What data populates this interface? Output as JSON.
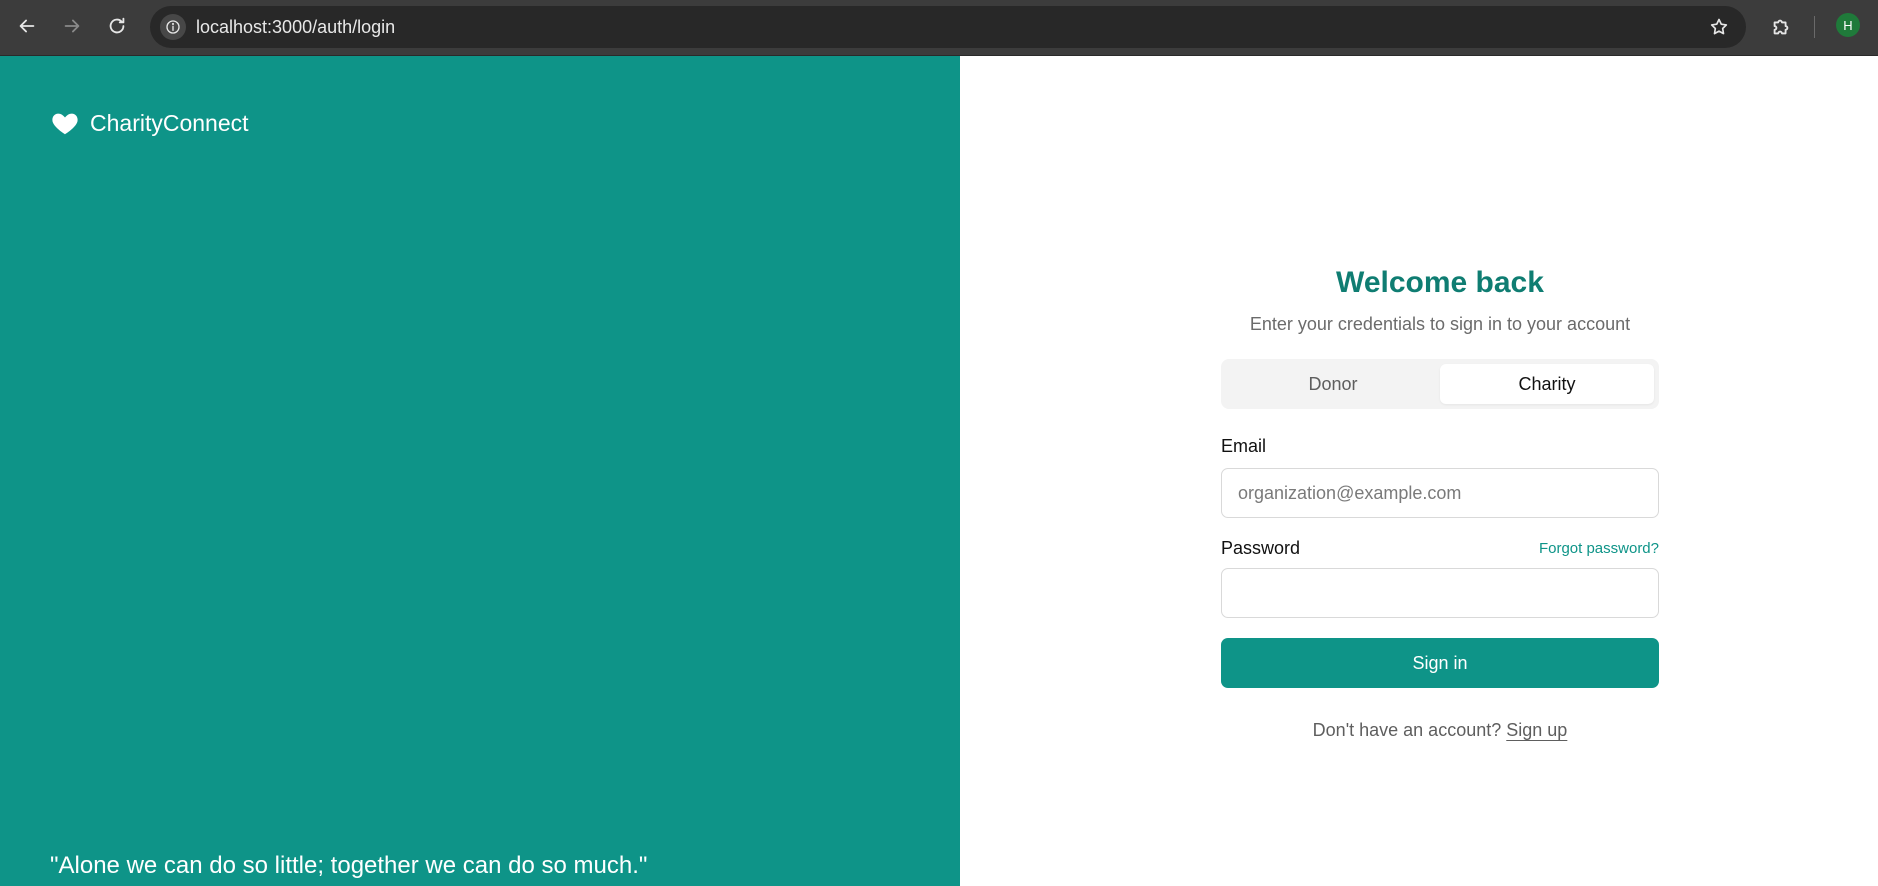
{
  "browser": {
    "url": "localhost:3000/auth/login",
    "profile_initial": "H",
    "profile_color": "#1f7a3a"
  },
  "icons": {
    "back": "arrow-left-icon",
    "forward": "arrow-right-icon",
    "reload": "reload-icon",
    "site_info": "info-icon",
    "bookmark": "star-icon",
    "extensions": "puzzle-icon",
    "brand": "heart-icon"
  },
  "brand": {
    "name": "CharityConnect",
    "color": "#0e9488"
  },
  "quote": "\"Alone we can do so little; together we can do so much.\"",
  "login": {
    "title": "Welcome back",
    "subtitle": "Enter your credentials to sign in to your account",
    "tabs": [
      {
        "label": "Donor",
        "active": false
      },
      {
        "label": "Charity",
        "active": true
      }
    ],
    "email_label": "Email",
    "email_placeholder": "organization@example.com",
    "email_value": "",
    "password_label": "Password",
    "password_value": "",
    "forgot_label": "Forgot password?",
    "submit_label": "Sign in",
    "signup_prompt": "Don't have an account?",
    "signup_label": "Sign up"
  }
}
